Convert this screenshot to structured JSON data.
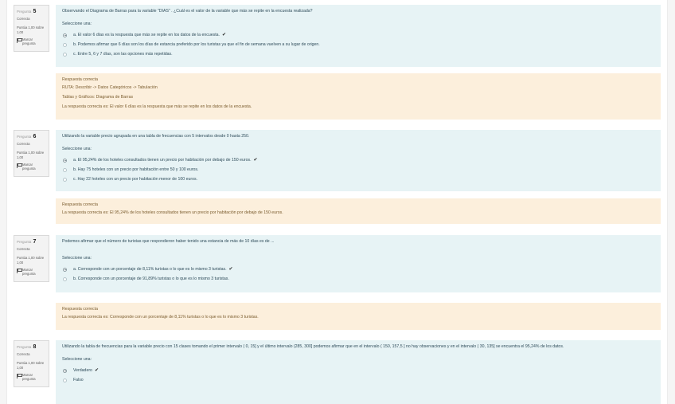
{
  "questions": [
    {
      "label": "Pregunta",
      "number": "5",
      "state": "Correcta",
      "grade": "Puntúa 1,00 sobre 1,00",
      "flag": "Marcar pregunta",
      "text": "Observando el Diagrama de Barras para la variable \"DIAS\" . ¿Cuál es el valor de la variable que más se repite en la encuesta realizada?",
      "prompt": "Seleccione una:",
      "options": [
        {
          "text": "a. El valor 6 días es la respuesta que más se repite en los datos de la encuesta.",
          "checked": true,
          "mark": "✔"
        },
        {
          "text": "b. Podemos afirmar que 6 días son los días de estancia preferido por los turistas ya que el fin de semana vuelven a su lugar de origen.",
          "checked": false,
          "mark": ""
        },
        {
          "text": "c. Entre 5, 6 y 7 días, son las opciones más repetidas.",
          "checked": false,
          "mark": ""
        }
      ],
      "feedback": [
        "Respuesta correcta",
        "RUTA: Describir -> Datos Categóricos -> Tabulación",
        "Tablas y Gráficos: Diagrama de Barras",
        "La respuesta correcta es: El valor 6 días es la respuesta que más se repite en los datos de la encuesta."
      ]
    },
    {
      "label": "Pregunta",
      "number": "6",
      "state": "Correcta",
      "grade": "Puntúa 1,00 sobre 1,00",
      "flag": "Marcar pregunta",
      "text": "Utilizando la variable precio agrupada en una tabla de frecuencias con 5 intervalos desde 0 hasta 250.",
      "prompt": "Seleccione una:",
      "options": [
        {
          "text": "a. El 95,24% de los hoteles consultados tienen un precio por habitación por debajo de 150 euros.",
          "checked": true,
          "mark": "✔"
        },
        {
          "text": "b. Hay 75 hoteles con un precio por habitación entre 50 y 100 euros.",
          "checked": false,
          "mark": ""
        },
        {
          "text": "c. Hay 22 hoteles con un precio por habitación menor de 100 euros.",
          "checked": false,
          "mark": ""
        }
      ],
      "feedback": [
        "Respuesta correcta",
        "La respuesta correcta es: El 95,24% de los hoteles consultados tienen un precio por habitación por debajo de 150 euros."
      ]
    },
    {
      "label": "Pregunta",
      "number": "7",
      "state": "Correcta",
      "grade": "Puntúa 1,00 sobre 1,00",
      "flag": "Marcar pregunta",
      "text": "Podemos afirmar que el número de turistas que respondieron haber tenido una estancia de más de 10 días es de ...",
      "prompt": "Seleccione una:",
      "options": [
        {
          "text": "a. Corresponde con un porcentaje de 8,11% turistas o lo que es lo mismo 3 turistas.",
          "checked": true,
          "mark": "✔"
        },
        {
          "text": "b. Corresponde con un porcentaje de 91,89% turistas o lo que es lo mismo 3 turistas.",
          "checked": false,
          "mark": ""
        }
      ],
      "feedback": [
        "Respuesta correcta",
        "La respuesta correcta es: Corresponde con un porcentaje de 8,11% turistas o lo que es lo mismo 3 turistas."
      ]
    },
    {
      "label": "Pregunta",
      "number": "8",
      "state": "Correcta",
      "grade": "Puntúa 1,00 sobre 1,00",
      "flag": "Marcar pregunta",
      "text": "Utilizando la tabla de frecuencias para la variable precio con 15 clases tomando el primer intervalo ( 0, 15] y el último intervalo (285, 300] podemos afirmar que en el intervalo ( 150, 157,5 ] no hay observaciones y en el intervalo ( 30, 135] se encuentra el 95,24% de los datos.",
      "prompt": "Seleccione una:",
      "options": [
        {
          "text": "Verdadero",
          "checked": true,
          "mark": "✔"
        },
        {
          "text": "Falso",
          "checked": false,
          "mark": ""
        }
      ],
      "feedback": []
    }
  ]
}
